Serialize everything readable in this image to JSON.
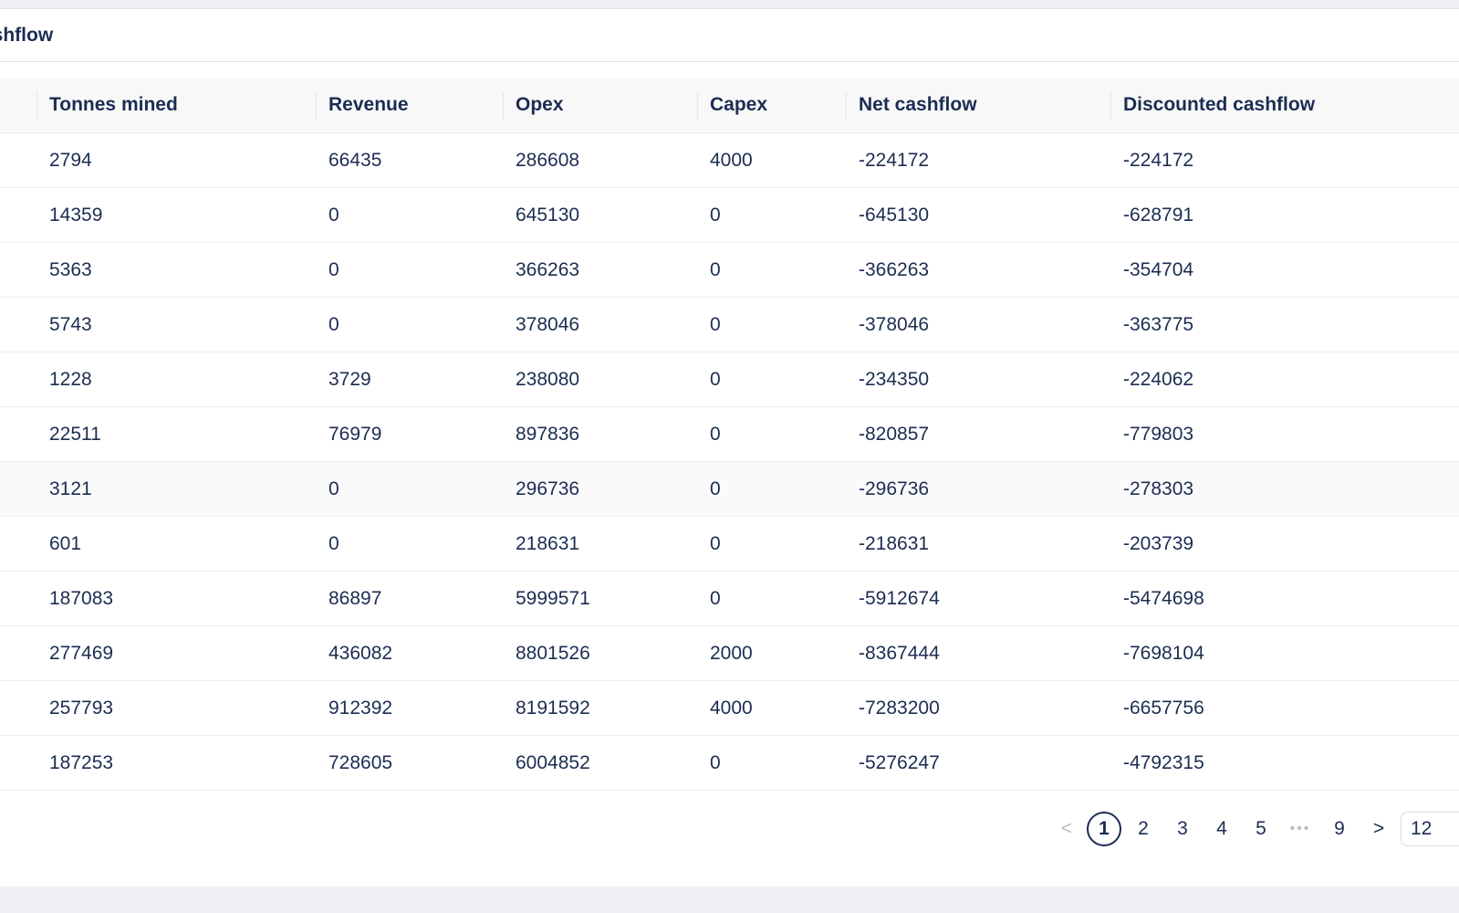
{
  "card": {
    "title": "ashflow"
  },
  "table": {
    "columns": [
      "Tonnes mined",
      "Revenue",
      "Opex",
      "Capex",
      "Net cashflow",
      "Discounted cashflow"
    ],
    "rows": [
      [
        "2794",
        "66435",
        "286608",
        "4000",
        "-224172",
        "-224172"
      ],
      [
        "14359",
        "0",
        "645130",
        "0",
        "-645130",
        "-628791"
      ],
      [
        "5363",
        "0",
        "366263",
        "0",
        "-366263",
        "-354704"
      ],
      [
        "5743",
        "0",
        "378046",
        "0",
        "-378046",
        "-363775"
      ],
      [
        "1228",
        "3729",
        "238080",
        "0",
        "-234350",
        "-224062"
      ],
      [
        "22511",
        "76979",
        "897836",
        "0",
        "-820857",
        "-779803"
      ],
      [
        "3121",
        "0",
        "296736",
        "0",
        "-296736",
        "-278303"
      ],
      [
        "601",
        "0",
        "218631",
        "0",
        "-218631",
        "-203739"
      ],
      [
        "187083",
        "86897",
        "5999571",
        "0",
        "-5912674",
        "-5474698"
      ],
      [
        "277469",
        "436082",
        "8801526",
        "2000",
        "-8367444",
        "-7698104"
      ],
      [
        "257793",
        "912392",
        "8191592",
        "4000",
        "-7283200",
        "-6657756"
      ],
      [
        "187253",
        "728605",
        "6004852",
        "0",
        "-5276247",
        "-4792315"
      ]
    ]
  },
  "pagination": {
    "prev": "<",
    "pages": [
      "1",
      "2",
      "3",
      "4",
      "5"
    ],
    "ellipsis": "•••",
    "last": "9",
    "next": ">",
    "active_page": "1",
    "page_size": "12"
  }
}
